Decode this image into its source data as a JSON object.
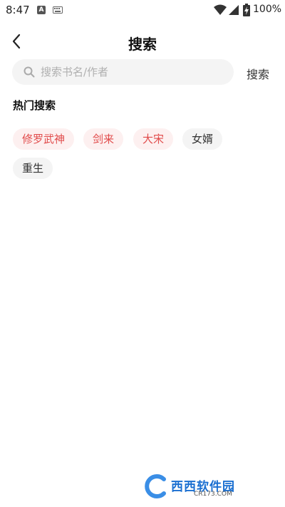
{
  "status_bar": {
    "time": "8:47",
    "app_indicator": "A",
    "battery": "100%"
  },
  "header": {
    "title": "搜索"
  },
  "search": {
    "placeholder": "搜索书名/作者",
    "value": "",
    "button": "搜索"
  },
  "hot": {
    "title": "热门搜索",
    "tags": [
      {
        "label": "修罗武神",
        "highlight": true
      },
      {
        "label": "剑来",
        "highlight": true
      },
      {
        "label": "大宋",
        "highlight": true
      },
      {
        "label": "女婿",
        "highlight": false
      },
      {
        "label": "重生",
        "highlight": false
      }
    ]
  },
  "colors": {
    "accent": "#e14b4b",
    "tag_hot_bg": "#fdf0f0",
    "tag_bg": "#f4f4f4"
  },
  "watermark": {
    "text": "西西软件园",
    "sub": "CR173.COM"
  }
}
